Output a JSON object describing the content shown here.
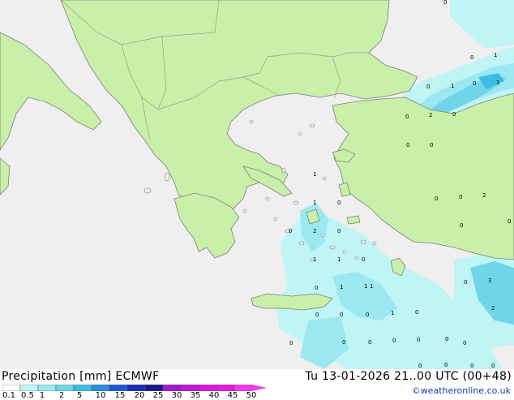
{
  "product": {
    "title": "Precipitation [mm]",
    "model": "ECMWF",
    "valid": "Tu 13-01-2026 21..00 UTC (00+48)",
    "credit": "©weatheronline.co.uk"
  },
  "colors": {
    "sea": "#efefef",
    "land": "#c8f0a8",
    "coast": "#7f7f7f",
    "border": "#9a9a9a"
  },
  "legend": {
    "ticks": [
      "0.1",
      "0.5",
      "1",
      "2",
      "5",
      "10",
      "15",
      "20",
      "25",
      "30",
      "35",
      "40",
      "45",
      "50"
    ],
    "colors": [
      "#ffffff",
      "#bff5f5",
      "#9be8f0",
      "#6fd6ea",
      "#3cbfe0",
      "#2a8fe0",
      "#1e5ad8",
      "#1b2cb8",
      "#1a1a8c",
      "#a31ad0",
      "#c01ad8",
      "#d81ad8",
      "#e81ae0",
      "#f03ce8"
    ]
  },
  "values": [
    "0",
    "1",
    "0",
    "1",
    "0",
    "1",
    "0",
    "2",
    "0",
    "0",
    "0",
    "1",
    "1",
    "0",
    "2",
    "0",
    "0",
    "0",
    "0",
    "1",
    "1",
    "0",
    "2",
    "0",
    "0",
    "0",
    "1",
    "0",
    "1",
    "1",
    "1",
    "0",
    "0",
    "0",
    "0",
    "0",
    "0",
    "0",
    "0",
    "0",
    "0",
    "3",
    "0",
    "2",
    "0",
    "0",
    "0",
    "0",
    "0"
  ]
}
